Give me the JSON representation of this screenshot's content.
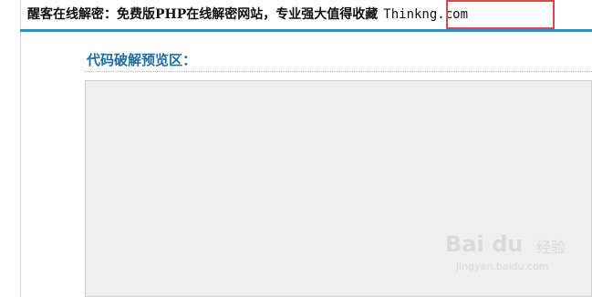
{
  "header": {
    "headline": "醒客在线解密：免费版PHP在线解密网站，专业强大值得收藏",
    "domain": "Thinkng.com"
  },
  "section": {
    "title": "代码破解预览区："
  },
  "watermark": {
    "brand": "Bai du",
    "jingyan": "经验",
    "url": "jingyan.baidu.com"
  },
  "colors": {
    "accent_bar": "#2e8ec6",
    "section_title": "#1c6ea4",
    "highlight_box": "#e0454a",
    "preview_bg": "#efefef"
  }
}
